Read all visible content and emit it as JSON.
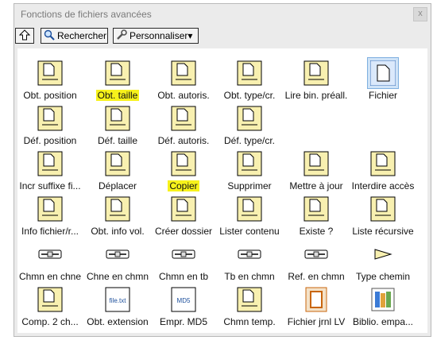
{
  "window": {
    "title": "Fonctions de fichiers avancées",
    "close_glyph": "x"
  },
  "toolbar": {
    "up_icon": "up-arrow-icon",
    "search_label": "Rechercher",
    "customize_label": "Personnaliser▾"
  },
  "colors": {
    "highlight": "#f7f21b",
    "selected_bg": "#cfe3f7",
    "icon_fill": "#f8f0b0"
  },
  "rows": [
    [
      {
        "label": "Obt. position",
        "icon": "file-position-icon"
      },
      {
        "label": "Obt. taille",
        "icon": "file-size-icon",
        "highlight": true
      },
      {
        "label": "Obt. autoris.",
        "icon": "file-permissions-icon"
      },
      {
        "label": "Obt. type/cr.",
        "icon": "file-type-icon"
      },
      {
        "label": "Lire bin. préall.",
        "icon": "read-binary-icon"
      },
      {
        "label": "Fichier",
        "icon": "file-icon",
        "selected": true
      }
    ],
    [
      {
        "label": "Déf. position",
        "icon": "set-position-icon"
      },
      {
        "label": "Déf. taille",
        "icon": "set-size-icon"
      },
      {
        "label": "Déf. autoris.",
        "icon": "set-permissions-icon"
      },
      {
        "label": "Déf. type/cr.",
        "icon": "set-type-icon"
      }
    ],
    [
      {
        "label": "Incr suffixe fi...",
        "icon": "increment-suffix-icon"
      },
      {
        "label": "Déplacer",
        "icon": "move-icon"
      },
      {
        "label": "Copier",
        "icon": "copy-icon",
        "highlight": true
      },
      {
        "label": "Supprimer",
        "icon": "delete-icon"
      },
      {
        "label": "Mettre à jour",
        "icon": "update-icon"
      },
      {
        "label": "Interdire accès",
        "icon": "deny-access-icon"
      }
    ],
    [
      {
        "label": "Info fichier/r...",
        "icon": "file-info-icon"
      },
      {
        "label": "Obt. info vol.",
        "icon": "volume-info-icon"
      },
      {
        "label": "Créer dossier",
        "icon": "create-folder-icon"
      },
      {
        "label": "Lister contenu",
        "icon": "list-contents-icon"
      },
      {
        "label": "Existe ?",
        "icon": "exists-icon"
      },
      {
        "label": "Liste récursive",
        "icon": "recursive-list-icon"
      }
    ],
    [
      {
        "label": "Chmn en chne",
        "icon": "path-to-string-icon"
      },
      {
        "label": "Chne en chmn",
        "icon": "string-to-path-icon"
      },
      {
        "label": "Chmn en tb",
        "icon": "path-to-array-icon"
      },
      {
        "label": "Tb en chmn",
        "icon": "array-to-path-icon"
      },
      {
        "label": "Ref. en chmn",
        "icon": "refnum-to-path-icon"
      },
      {
        "label": "Type chemin",
        "icon": "path-type-icon"
      }
    ],
    [
      {
        "label": "Comp. 2 ch...",
        "icon": "compare-paths-icon"
      },
      {
        "label": "Obt. extension",
        "icon": "get-extension-icon",
        "glyph": "file.txt"
      },
      {
        "label": "Empr. MD5",
        "icon": "md5-icon",
        "glyph": "MD5"
      },
      {
        "label": "Chmn temp.",
        "icon": "temp-path-icon"
      },
      {
        "label": "Fichier jrnl LV",
        "icon": "lv-log-file-icon"
      },
      {
        "label": "Biblio. empa...",
        "icon": "packed-library-icon"
      }
    ]
  ]
}
